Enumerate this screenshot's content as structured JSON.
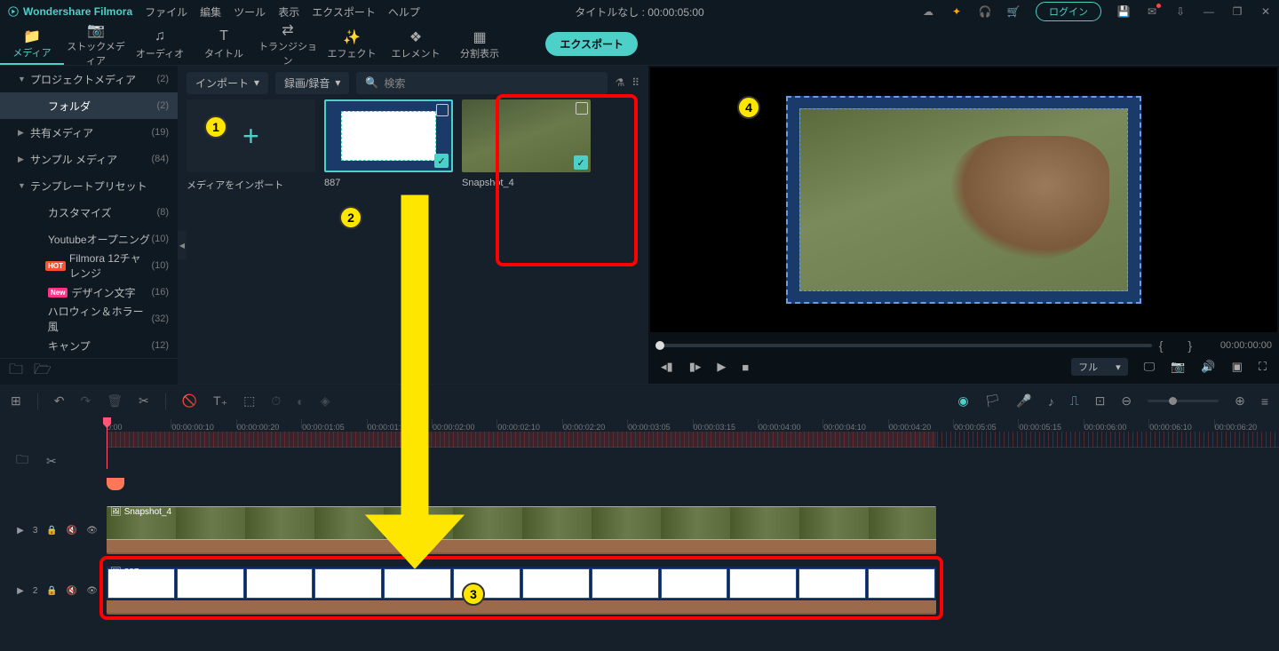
{
  "titlebar": {
    "app_name": "Wondershare Filmora",
    "menus": [
      "ファイル",
      "編集",
      "ツール",
      "表示",
      "エクスポート",
      "ヘルプ"
    ],
    "center_title": "タイトルなし : 00:00:05:00",
    "login": "ログイン"
  },
  "tabs": [
    {
      "label": "メディア",
      "active": true
    },
    {
      "label": "ストックメディア",
      "active": false
    },
    {
      "label": "オーディオ",
      "active": false
    },
    {
      "label": "タイトル",
      "active": false
    },
    {
      "label": "トランジション",
      "active": false
    },
    {
      "label": "エフェクト",
      "active": false
    },
    {
      "label": "エレメント",
      "active": false
    },
    {
      "label": "分割表示",
      "active": false
    }
  ],
  "export_button": "エクスポート",
  "sidebar": {
    "items": [
      {
        "label": "プロジェクトメディア",
        "count": "(2)",
        "arrow": "▼",
        "sel": false,
        "sub": false
      },
      {
        "label": "フォルダ",
        "count": "(2)",
        "arrow": "",
        "sel": true,
        "sub": true
      },
      {
        "label": "共有メディア",
        "count": "(19)",
        "arrow": "▶",
        "sel": false,
        "sub": false
      },
      {
        "label": "サンプル メディア",
        "count": "(84)",
        "arrow": "▶",
        "sel": false,
        "sub": false
      },
      {
        "label": "テンプレートプリセット",
        "count": "",
        "arrow": "▼",
        "sel": false,
        "sub": false
      },
      {
        "label": "カスタマイズ",
        "count": "(8)",
        "arrow": "",
        "sel": false,
        "sub": true
      },
      {
        "label": "Youtubeオープニング",
        "count": "(10)",
        "arrow": "",
        "sel": false,
        "sub": true
      },
      {
        "label": "Filmora 12チャレンジ",
        "count": "(10)",
        "arrow": "",
        "sel": false,
        "sub": true,
        "badge": "HOT"
      },
      {
        "label": "デザイン文字",
        "count": "(16)",
        "arrow": "",
        "sel": false,
        "sub": true,
        "badge": "New"
      },
      {
        "label": "ハロウィン＆ホラー風",
        "count": "(32)",
        "arrow": "",
        "sel": false,
        "sub": true
      },
      {
        "label": "キャンプ",
        "count": "(12)",
        "arrow": "",
        "sel": false,
        "sub": true
      }
    ]
  },
  "media_toolbar": {
    "import": "インポート",
    "record": "録画/録音",
    "search_placeholder": "検索"
  },
  "media_items": [
    {
      "label": "メディアをインポート",
      "type": "import"
    },
    {
      "label": "887",
      "type": "frame"
    },
    {
      "label": "Snapshot_4",
      "type": "deer"
    }
  ],
  "preview": {
    "timecode": "00:00:00:00",
    "quality": "フル"
  },
  "ruler_ticks": [
    "0:00",
    "00:00:00:10",
    "00:00:00:20",
    "00:00:01:05",
    "00:00:01:15",
    "00:00:02:00",
    "00:00:02:10",
    "00:00:02:20",
    "00:00:03:05",
    "00:00:03:15",
    "00:00:04:00",
    "00:00:04:10",
    "00:00:04:20",
    "00:00:05:05",
    "00:00:05:15",
    "00:00:06:00",
    "00:00:06:10",
    "00:00:06:20"
  ],
  "tracks": {
    "t3": {
      "num": "3",
      "clip_label": "Snapshot_4"
    },
    "t2": {
      "num": "2",
      "clip_label": "887"
    }
  },
  "markers": {
    "m1": "1",
    "m2": "2",
    "m3": "3",
    "m4": "4"
  }
}
